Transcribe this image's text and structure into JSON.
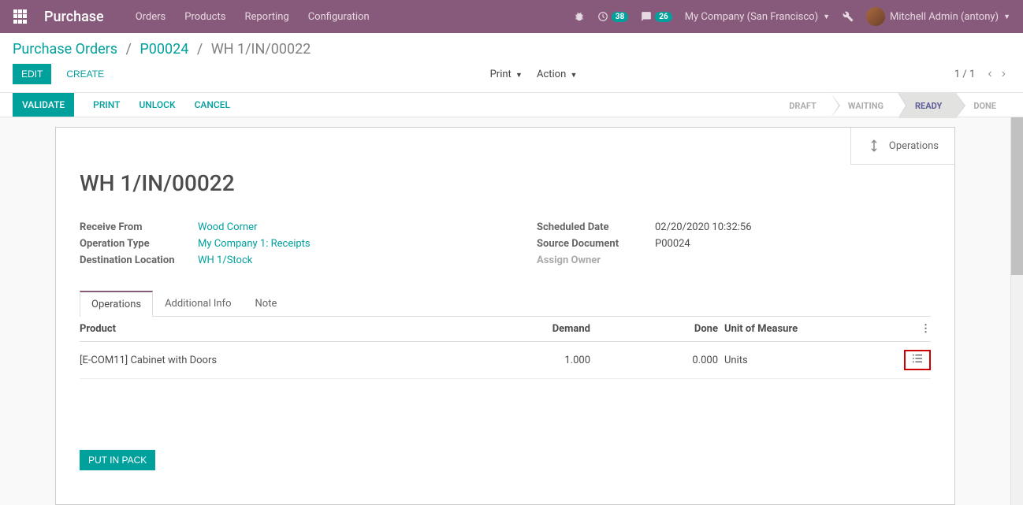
{
  "navbar": {
    "brand": "Purchase",
    "menu": [
      "Orders",
      "Products",
      "Reporting",
      "Configuration"
    ],
    "badge1": "38",
    "badge2": "26",
    "company": "My Company (San Francisco)",
    "user": "Mitchell Admin (antony)"
  },
  "breadcrumb": {
    "l1": "Purchase Orders",
    "l2": "P00024",
    "l3": "WH 1/IN/00022"
  },
  "cp": {
    "edit": "EDIT",
    "create": "CREATE",
    "print": "Print",
    "action": "Action",
    "pager": "1 / 1"
  },
  "statusbar": {
    "validate": "VALIDATE",
    "print": "PRINT",
    "unlock": "UNLOCK",
    "cancel": "CANCEL",
    "statuses": [
      "DRAFT",
      "WAITING",
      "READY",
      "DONE"
    ]
  },
  "sheet": {
    "operations_btn": "Operations",
    "title": "WH 1/IN/00022",
    "fields_left": {
      "receive_from": {
        "label": "Receive From",
        "value": "Wood Corner"
      },
      "operation_type": {
        "label": "Operation Type",
        "value": "My Company 1: Receipts"
      },
      "destination": {
        "label": "Destination Location",
        "value": "WH 1/Stock"
      }
    },
    "fields_right": {
      "scheduled_date": {
        "label": "Scheduled Date",
        "value": "02/20/2020 10:32:56"
      },
      "source_doc": {
        "label": "Source Document",
        "value": "P00024"
      },
      "assign_owner": {
        "label": "Assign Owner",
        "value": ""
      }
    },
    "tabs": [
      "Operations",
      "Additional Info",
      "Note"
    ],
    "table": {
      "headers": {
        "product": "Product",
        "demand": "Demand",
        "done": "Done",
        "uom": "Unit of Measure"
      },
      "rows": [
        {
          "product": "[E-COM11] Cabinet with Doors",
          "demand": "1.000",
          "done": "0.000",
          "uom": "Units"
        }
      ]
    },
    "put_in_pack": "PUT IN PACK"
  }
}
